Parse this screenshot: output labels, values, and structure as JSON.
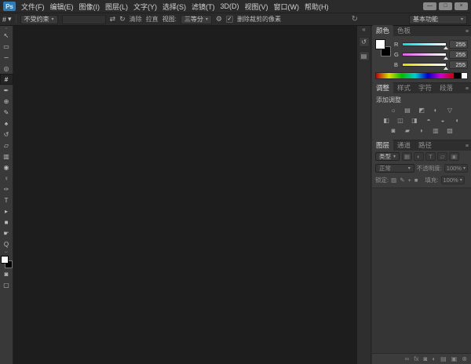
{
  "window": {
    "logo_text": "Ps",
    "minimize_glyph": "—",
    "maximize_glyph": "□",
    "close_glyph": "×"
  },
  "menubar": {
    "items": [
      "文件(F)",
      "编辑(E)",
      "图像(I)",
      "图层(L)",
      "文字(Y)",
      "选择(S)",
      "滤镜(T)",
      "3D(D)",
      "视图(V)",
      "窗口(W)",
      "帮助(H)"
    ]
  },
  "options": {
    "tool_icon_glyph": "#",
    "preset_arrow": "▾",
    "aspect_value": "不受约束",
    "ratio_field_value": "",
    "swap_glyph": "⇄",
    "rotate_glyph": "↻",
    "clear_label": "清除",
    "straighten_label": "拉直",
    "view_label": "视图:",
    "view_value": "三等分",
    "gear_glyph": "⚙",
    "check_glyph": "✓",
    "delete_pixels_label": "删除裁剪的像素",
    "refresh_glyph": "↻",
    "workspace_label": "基本功能"
  },
  "toolbar": {
    "grip_glyph": "▪▪",
    "tools": [
      {
        "name": "move-tool",
        "glyph": "↖"
      },
      {
        "name": "rectangular-marquee-tool",
        "glyph": "▭"
      },
      {
        "name": "lasso-tool",
        "glyph": "∽"
      },
      {
        "name": "quick-selection-tool",
        "glyph": "◎"
      },
      {
        "name": "crop-tool",
        "glyph": "#",
        "selected": true
      },
      {
        "name": "eyedropper-tool",
        "glyph": "✒"
      },
      {
        "name": "spot-healing-brush-tool",
        "glyph": "⊕"
      },
      {
        "name": "brush-tool",
        "glyph": "✎"
      },
      {
        "name": "clone-stamp-tool",
        "glyph": "♠"
      },
      {
        "name": "history-brush-tool",
        "glyph": "↺"
      },
      {
        "name": "eraser-tool",
        "glyph": "▱"
      },
      {
        "name": "gradient-tool",
        "glyph": "▥"
      },
      {
        "name": "blur-tool",
        "glyph": "◉"
      },
      {
        "name": "dodge-tool",
        "glyph": "♀"
      },
      {
        "name": "pen-tool",
        "glyph": "✑"
      },
      {
        "name": "type-tool",
        "glyph": "T"
      },
      {
        "name": "path-selection-tool",
        "glyph": "▸"
      },
      {
        "name": "rectangle-shape-tool",
        "glyph": "■"
      },
      {
        "name": "hand-tool",
        "glyph": "☛"
      },
      {
        "name": "zoom-tool",
        "glyph": "Q"
      }
    ],
    "swap_colors_glyph": "↔",
    "foreground_color": "#ffffff",
    "background_color": "#000000",
    "quick_mask_glyph": "◙",
    "screen_mode_glyph": "▢"
  },
  "dock_strip": {
    "collapse_glyph": "«",
    "icons": [
      {
        "name": "history-panel-icon",
        "glyph": "↺"
      },
      {
        "name": "properties-panel-icon",
        "glyph": "▤"
      }
    ]
  },
  "color_panel": {
    "tabs": [
      "颜色",
      "色板"
    ],
    "menu_glyph": "≡",
    "sliders": [
      {
        "channel": "R",
        "value": "255"
      },
      {
        "channel": "G",
        "value": "255"
      },
      {
        "channel": "B",
        "value": "255"
      }
    ]
  },
  "adjustments_panel": {
    "tabs": [
      "调整",
      "样式",
      "字符",
      "段落"
    ],
    "menu_glyph": "≡",
    "add_label": "添加调整",
    "row1": [
      {
        "name": "brightness-contrast-icon",
        "glyph": "☼"
      },
      {
        "name": "levels-icon",
        "glyph": "▤"
      },
      {
        "name": "curves-icon",
        "glyph": "◩"
      },
      {
        "name": "exposure-icon",
        "glyph": "◐"
      },
      {
        "name": "vibrance-icon",
        "glyph": "▽"
      }
    ],
    "row2": [
      {
        "name": "hue-saturation-icon",
        "glyph": "◧"
      },
      {
        "name": "color-balance-icon",
        "glyph": "◫"
      },
      {
        "name": "black-white-icon",
        "glyph": "◨"
      },
      {
        "name": "photo-filter-icon",
        "glyph": "◓"
      },
      {
        "name": "channel-mixer-icon",
        "glyph": "◒"
      },
      {
        "name": "color-lookup-icon",
        "glyph": "◖"
      }
    ],
    "row3": [
      {
        "name": "invert-icon",
        "glyph": "◙"
      },
      {
        "name": "posterize-icon",
        "glyph": "▰"
      },
      {
        "name": "threshold-icon",
        "glyph": "◗"
      },
      {
        "name": "gradient-map-icon",
        "glyph": "▥"
      },
      {
        "name": "selective-color-icon",
        "glyph": "▧"
      }
    ]
  },
  "layers_panel": {
    "tabs": [
      "图层",
      "通道",
      "路径"
    ],
    "menu_glyph": "≡",
    "filter_label": "类型",
    "filter_icons": [
      {
        "name": "filter-pixel-layers-icon",
        "glyph": "▦"
      },
      {
        "name": "filter-adjustment-layers-icon",
        "glyph": "◐"
      },
      {
        "name": "filter-type-layers-icon",
        "glyph": "T"
      },
      {
        "name": "filter-shape-layers-icon",
        "glyph": "▱"
      },
      {
        "name": "filter-smart-objects-icon",
        "glyph": "▣"
      }
    ],
    "blend_mode_value": "正常",
    "opacity_label": "不透明度:",
    "opacity_value": "100%",
    "lock_label": "锁定:",
    "lock_icons": [
      {
        "name": "lock-transparent-pixels-icon",
        "glyph": "▨"
      },
      {
        "name": "lock-image-pixels-icon",
        "glyph": "✎"
      },
      {
        "name": "lock-position-icon",
        "glyph": "+"
      },
      {
        "name": "lock-all-icon",
        "glyph": "■"
      }
    ],
    "fill_label": "填充:",
    "fill_value": "100%",
    "bottom_icons": [
      {
        "name": "link-layers-icon",
        "glyph": "∞"
      },
      {
        "name": "layer-style-icon",
        "glyph": "fx"
      },
      {
        "name": "layer-mask-icon",
        "glyph": "◙"
      },
      {
        "name": "new-adjustment-layer-icon",
        "glyph": "◐"
      },
      {
        "name": "new-group-icon",
        "glyph": "▤"
      },
      {
        "name": "new-layer-icon",
        "glyph": "▣"
      },
      {
        "name": "delete-layer-icon",
        "glyph": "⊗"
      }
    ]
  },
  "colors": {
    "logo_blue": "#2e7bb5",
    "chrome_bg": "#2b2b2b",
    "toolbar_bg": "#393939",
    "panel_bg": "#3c3c3c",
    "canvas_bg": "#1d1d1d",
    "slider_r_start": "#00dede",
    "slider_g_start": "#de5fde",
    "slider_b_start": "#dede00",
    "rgb_values": {
      "R": 255,
      "G": 255,
      "B": 255
    }
  }
}
